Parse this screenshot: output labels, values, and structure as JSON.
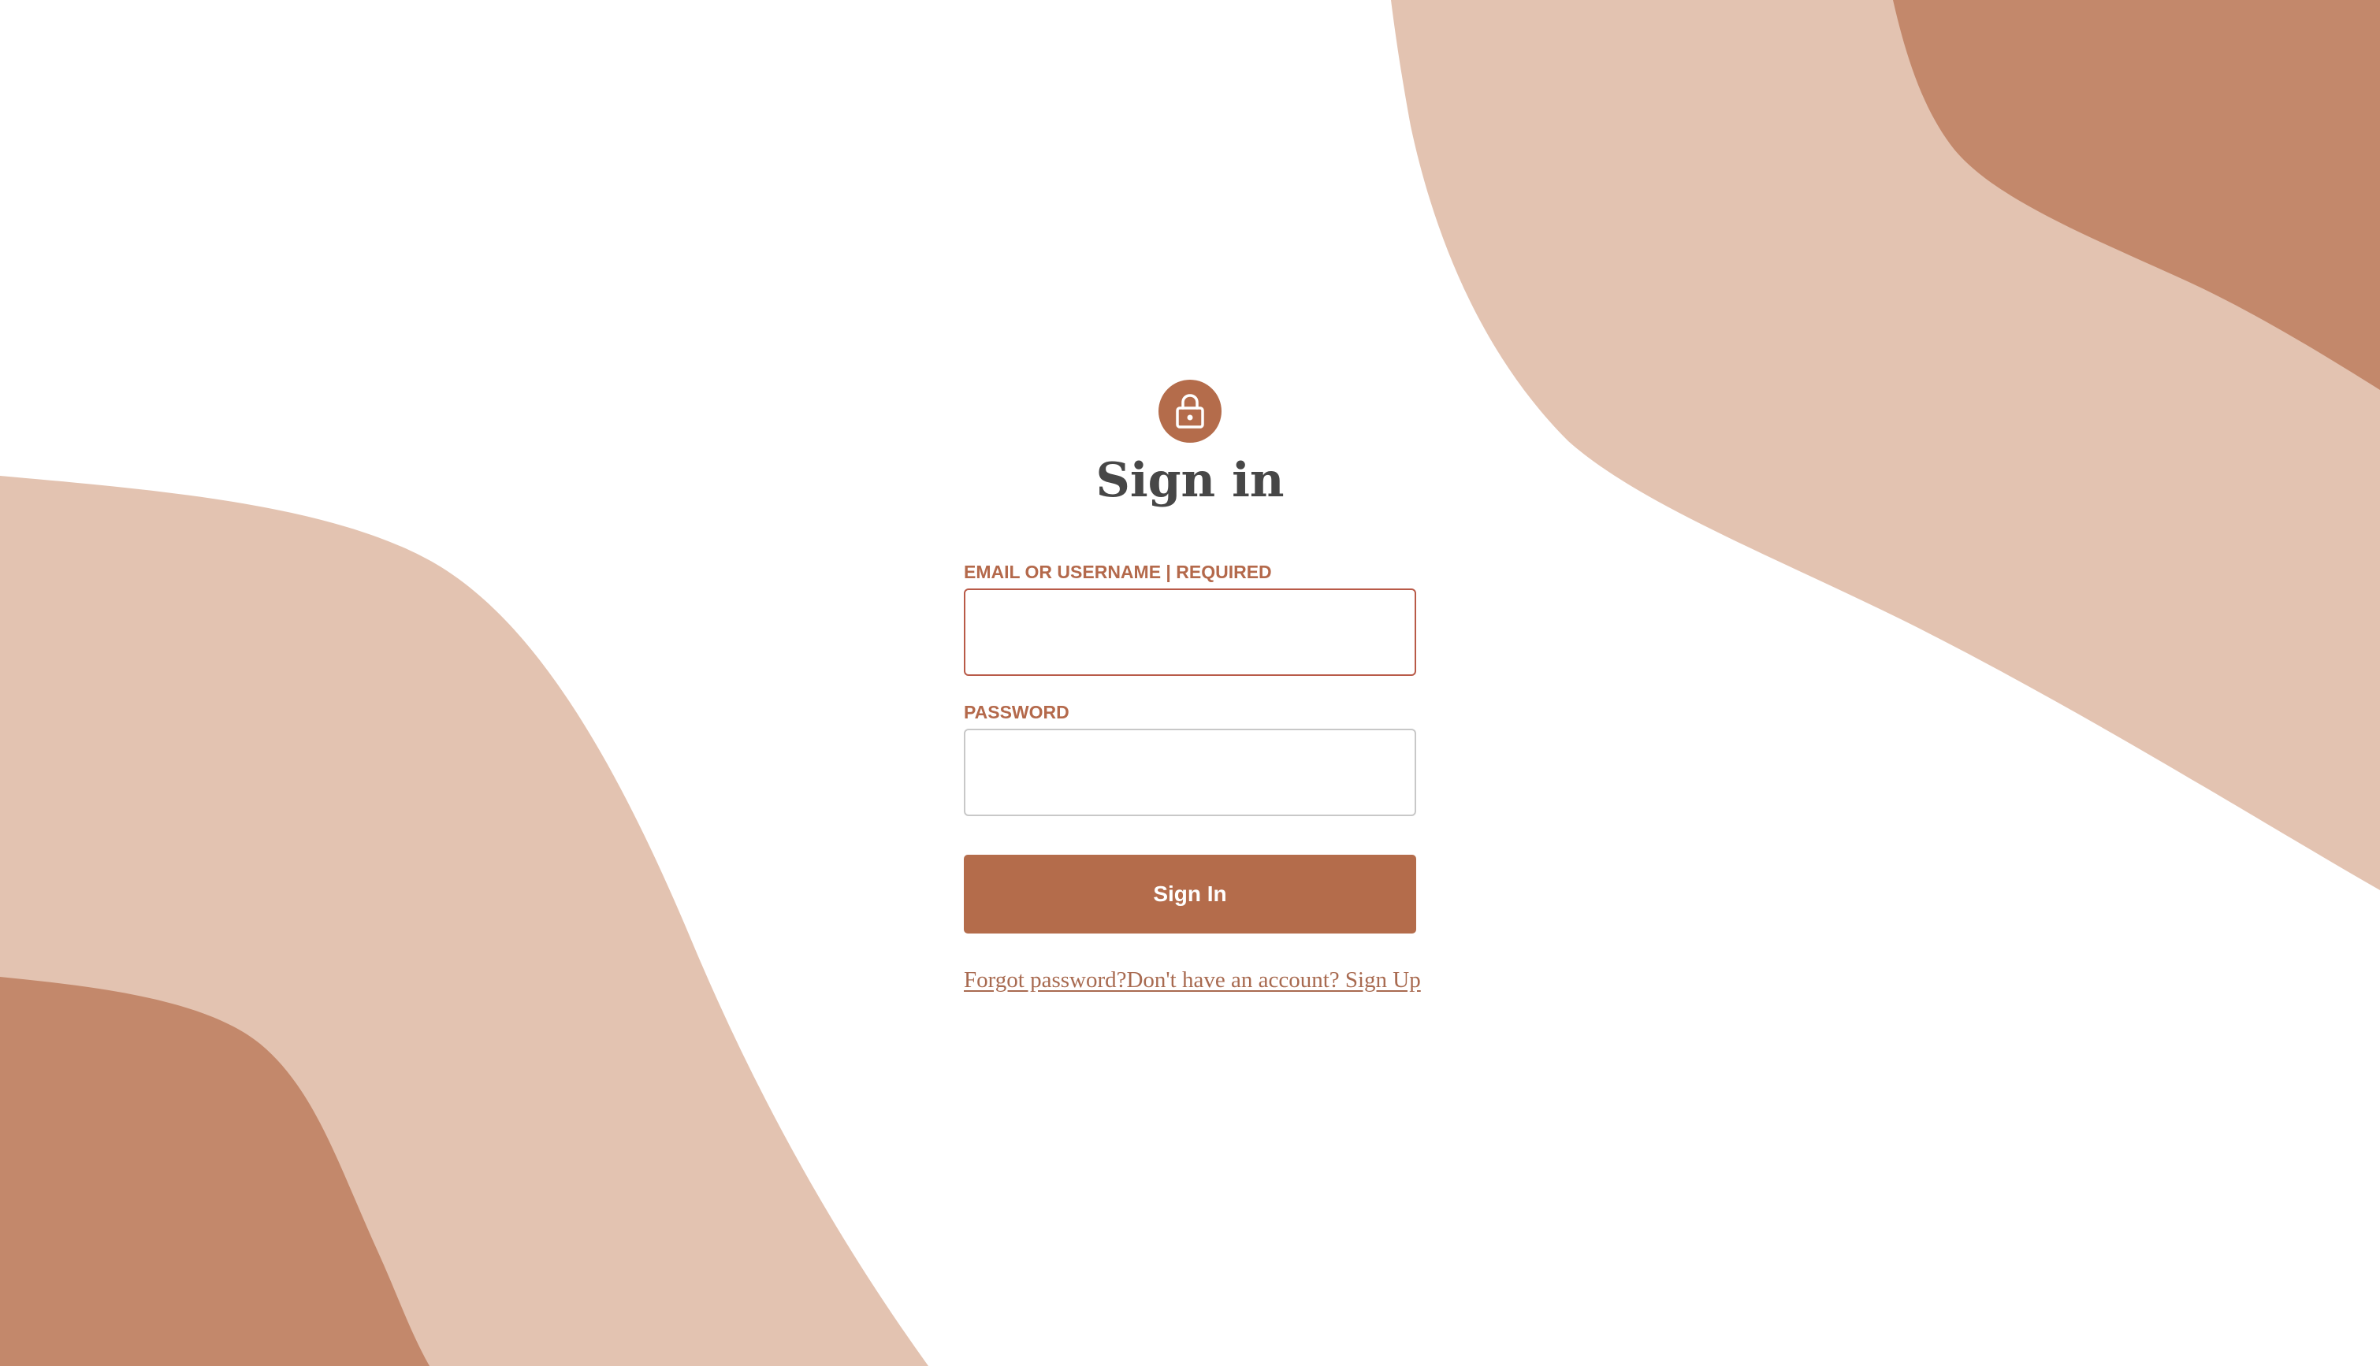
{
  "theme": {
    "accent": "#b46c4b",
    "shape_light": "#e3c3b1",
    "shape_dark": "#c3886b",
    "title_color": "#474747",
    "label_color": "#b4694b"
  },
  "header": {
    "icon": "lock-icon",
    "title": "Sign in"
  },
  "form": {
    "email_label": "EMAIL OR USERNAME | REQUIRED",
    "email_value": "",
    "email_placeholder": "",
    "password_label": "PASSWORD",
    "password_value": "",
    "password_placeholder": "",
    "submit_label": "Sign In"
  },
  "links": {
    "forgot_password": "Forgot password?",
    "sign_up": "Don't have an account? Sign Up"
  }
}
